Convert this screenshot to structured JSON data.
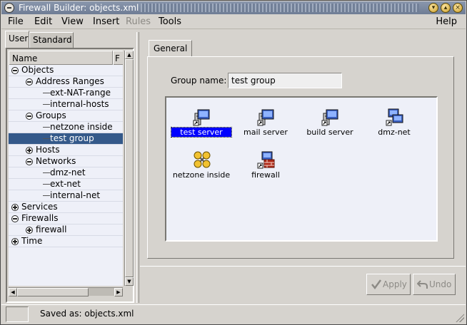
{
  "window": {
    "title": "Firewall Builder: objects.xml",
    "buttons": [
      "minimize-icon",
      "maximize-icon",
      "close-icon"
    ]
  },
  "menubar": {
    "items": [
      {
        "label": "File",
        "enabled": true
      },
      {
        "label": "Edit",
        "enabled": true
      },
      {
        "label": "View",
        "enabled": true
      },
      {
        "label": "Insert",
        "enabled": true
      },
      {
        "label": "Rules",
        "enabled": false
      },
      {
        "label": "Tools",
        "enabled": true
      }
    ],
    "help": "Help"
  },
  "left_panel": {
    "tabs": [
      {
        "label": "User",
        "active": true
      },
      {
        "label": "Standard",
        "active": false
      }
    ],
    "columns": {
      "name": "Name",
      "second": "F"
    },
    "tree": [
      {
        "label": "Objects",
        "depth": 0,
        "expander": "minus",
        "selected": false
      },
      {
        "label": "Address Ranges",
        "depth": 1,
        "expander": "minus",
        "selected": false
      },
      {
        "label": "ext-NAT-range",
        "depth": 2,
        "expander": "none",
        "selected": false
      },
      {
        "label": "internal-hosts",
        "depth": 2,
        "expander": "none",
        "selected": false
      },
      {
        "label": "Groups",
        "depth": 1,
        "expander": "minus",
        "selected": false
      },
      {
        "label": "netzone inside",
        "depth": 2,
        "expander": "none",
        "selected": false
      },
      {
        "label": "test group",
        "depth": 2,
        "expander": "none",
        "selected": true
      },
      {
        "label": "Hosts",
        "depth": 1,
        "expander": "plus",
        "selected": false
      },
      {
        "label": "Networks",
        "depth": 1,
        "expander": "minus",
        "selected": false
      },
      {
        "label": "dmz-net",
        "depth": 2,
        "expander": "none",
        "selected": false
      },
      {
        "label": "ext-net",
        "depth": 2,
        "expander": "none",
        "selected": false
      },
      {
        "label": "internal-net",
        "depth": 2,
        "expander": "none",
        "selected": false
      },
      {
        "label": "Services",
        "depth": 0,
        "expander": "plus",
        "selected": false
      },
      {
        "label": "Firewalls",
        "depth": 0,
        "expander": "minus",
        "selected": false
      },
      {
        "label": "firewall",
        "depth": 1,
        "expander": "plus",
        "selected": false
      },
      {
        "label": "Time",
        "depth": 0,
        "expander": "plus",
        "selected": false
      }
    ]
  },
  "right_panel": {
    "tab": "General",
    "group_name_label": "Group name:",
    "group_name_value": "test group",
    "members": [
      {
        "label": "test server",
        "icon": "host-icon",
        "selected": true
      },
      {
        "label": "mail server",
        "icon": "host-icon",
        "selected": false
      },
      {
        "label": "build server",
        "icon": "host-icon",
        "selected": false
      },
      {
        "label": "dmz-net",
        "icon": "network-icon",
        "selected": false
      },
      {
        "label": "netzone inside",
        "icon": "group-icon",
        "selected": false
      },
      {
        "label": "firewall",
        "icon": "firewall-icon",
        "selected": false
      }
    ],
    "apply_label": "Apply",
    "undo_label": "Undo"
  },
  "statusbar": {
    "text": "Saved as: objects.xml"
  }
}
